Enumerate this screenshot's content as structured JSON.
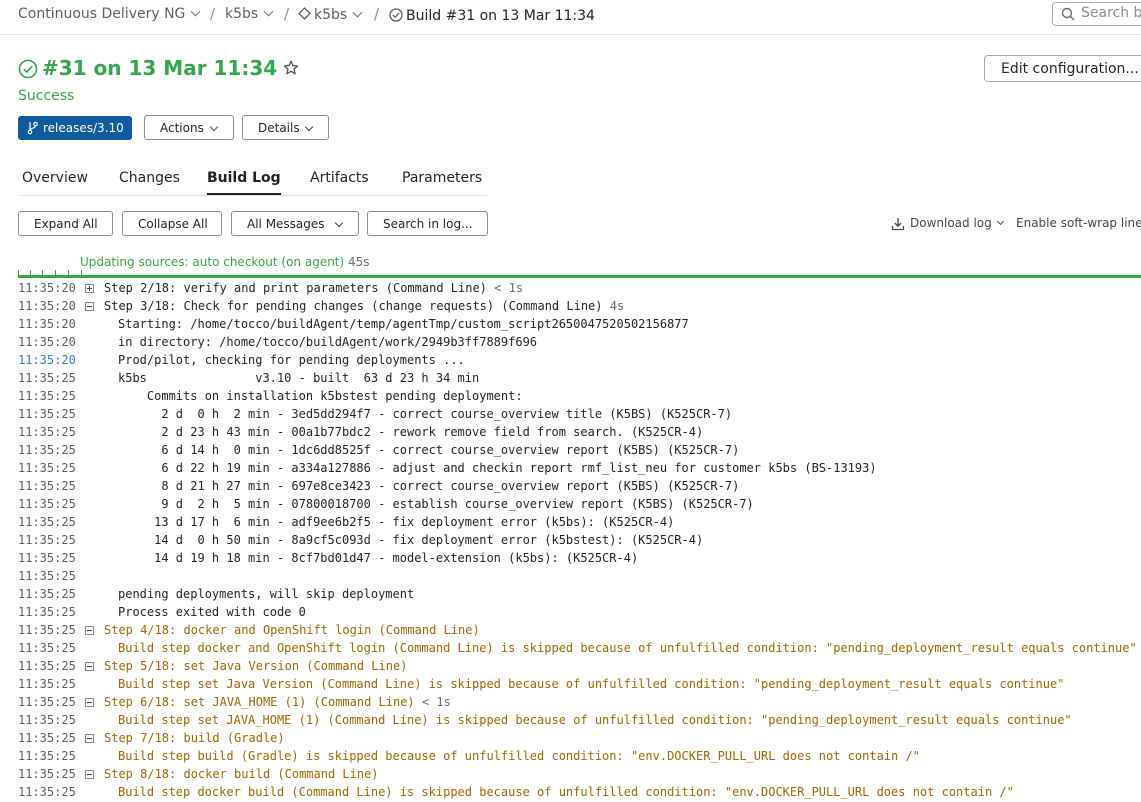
{
  "breadcrumb": {
    "project": "Continuous Delivery NG",
    "subproject": "k5bs",
    "build_config": "k5bs",
    "current": "Build #31 on 13 Mar 11:34",
    "separator": "/"
  },
  "search": {
    "placeholder": "Search b"
  },
  "header": {
    "title": "#31 on 13 Mar 11:34",
    "status": "Success",
    "edit_label": "Edit configuration...",
    "branch": "releases/3.10",
    "actions_label": "Actions",
    "details_label": "Details",
    "status_color": "#35a64a"
  },
  "tabs": [
    {
      "label": "Overview"
    },
    {
      "label": "Changes"
    },
    {
      "label": "Build Log",
      "active": true
    },
    {
      "label": "Artifacts"
    },
    {
      "label": "Parameters"
    }
  ],
  "toolbar": {
    "expand_all": "Expand All",
    "collapse_all": "Collapse All",
    "filter": "All Messages",
    "search_log": "Search in log...",
    "download_log": "Download log",
    "softwrap": "Enable soft-wrap lines"
  },
  "progress": {
    "label": "Updating sources: auto checkout (on agent)",
    "duration": "45s"
  },
  "log": [
    {
      "ts": "11:35:20",
      "toggle": "plus",
      "text": "Step 2/18: verify and print parameters (Command Line)",
      "dur": "< 1s"
    },
    {
      "ts": "11:35:20",
      "toggle": "minus",
      "text": "Step 3/18: Check for pending changes (change requests) (Command Line)",
      "dur": "4s"
    },
    {
      "ts": "11:35:20",
      "sub": true,
      "text": "Starting: /home/tocco/buildAgent/temp/agentTmp/custom_script2650047520502156877"
    },
    {
      "ts": "11:35:20",
      "sub": true,
      "text": "in directory: /home/tocco/buildAgent/work/2949b3ff7889f696"
    },
    {
      "ts": "11:35:20",
      "highlight": true,
      "sub": true,
      "text": "Prod/pilot, checking for pending deployments ..."
    },
    {
      "ts": "11:35:25",
      "sub": true,
      "text": "k5bs               v3.10 - built  63 d 23 h 34 min"
    },
    {
      "ts": "11:35:25",
      "sub": true,
      "text": "    Commits on installation k5bstest pending deployment:"
    },
    {
      "ts": "11:35:25",
      "sub": true,
      "text": "      2 d  0 h  2 min - 3ed5dd294f7 - correct course_overview title (K5BS) (K525CR-7)"
    },
    {
      "ts": "11:35:25",
      "sub": true,
      "text": "      2 d 23 h 43 min - 00a1b77bdc2 - rework remove field from search. (K525CR-4)"
    },
    {
      "ts": "11:35:25",
      "sub": true,
      "text": "      6 d 14 h  0 min - 1dc6dd8525f - correct course_overview report (K5BS) (K525CR-7)"
    },
    {
      "ts": "11:35:25",
      "sub": true,
      "text": "      6 d 22 h 19 min - a334a127886 - adjust and checkin report rmf_list_neu for customer k5bs (BS-13193)"
    },
    {
      "ts": "11:35:25",
      "sub": true,
      "text": "      8 d 21 h 27 min - 697e8ce3423 - correct course_overview report (K5BS) (K525CR-7)"
    },
    {
      "ts": "11:35:25",
      "sub": true,
      "text": "      9 d  2 h  5 min - 07800018700 - establish course_overview report (K5BS) (K525CR-7)"
    },
    {
      "ts": "11:35:25",
      "sub": true,
      "text": "     13 d 17 h  6 min - adf9ee6b2f5 - fix deployment error (k5bs): (K525CR-4)"
    },
    {
      "ts": "11:35:25",
      "sub": true,
      "text": "     14 d  0 h 50 min - 8a9cf5c093d - fix deployment error (k5bstest): (K525CR-4)"
    },
    {
      "ts": "11:35:25",
      "sub": true,
      "text": "     14 d 19 h 18 min - 8cf7bd01d47 - model-extension (k5bs): (K525CR-4)"
    },
    {
      "ts": "11:35:25",
      "sub": true,
      "text": ""
    },
    {
      "ts": "11:35:25",
      "sub": true,
      "text": "pending deployments, will skip deployment"
    },
    {
      "ts": "11:35:25",
      "sub": true,
      "text": "Process exited with code 0"
    },
    {
      "ts": "11:35:25",
      "toggle": "minus",
      "warn": true,
      "text": "Step 4/18: docker and OpenShift login (Command Line)"
    },
    {
      "ts": "11:35:25",
      "sub": true,
      "warn": true,
      "text": "Build step docker and OpenShift login (Command Line) is skipped because of unfulfilled condition: \"pending_deployment_result equals continue\""
    },
    {
      "ts": "11:35:25",
      "toggle": "minus",
      "warn": true,
      "text": "Step 5/18: set Java Version (Command Line)"
    },
    {
      "ts": "11:35:25",
      "sub": true,
      "warn": true,
      "text": "Build step set Java Version (Command Line) is skipped because of unfulfilled condition: \"pending_deployment_result equals continue\""
    },
    {
      "ts": "11:35:25",
      "toggle": "minus",
      "warn": true,
      "text": "Step 6/18: set JAVA_HOME (1) (Command Line)",
      "dur": "< 1s"
    },
    {
      "ts": "11:35:25",
      "sub": true,
      "warn": true,
      "text": "Build step set JAVA_HOME (1) (Command Line) is skipped because of unfulfilled condition: \"pending_deployment_result equals continue\""
    },
    {
      "ts": "11:35:25",
      "toggle": "minus",
      "warn": true,
      "text": "Step 7/18: build (Gradle)"
    },
    {
      "ts": "11:35:25",
      "sub": true,
      "warn": true,
      "text": "Build step build (Gradle) is skipped because of unfulfilled condition: \"env.DOCKER_PULL_URL does not contain /\""
    },
    {
      "ts": "11:35:25",
      "toggle": "minus",
      "warn": true,
      "text": "Step 8/18: docker build (Command Line)"
    },
    {
      "ts": "11:35:25",
      "sub": true,
      "warn": true,
      "text": "Build step docker build (Command Line) is skipped because of unfulfilled condition: \"env.DOCKER_PULL_URL does not contain /\""
    }
  ]
}
